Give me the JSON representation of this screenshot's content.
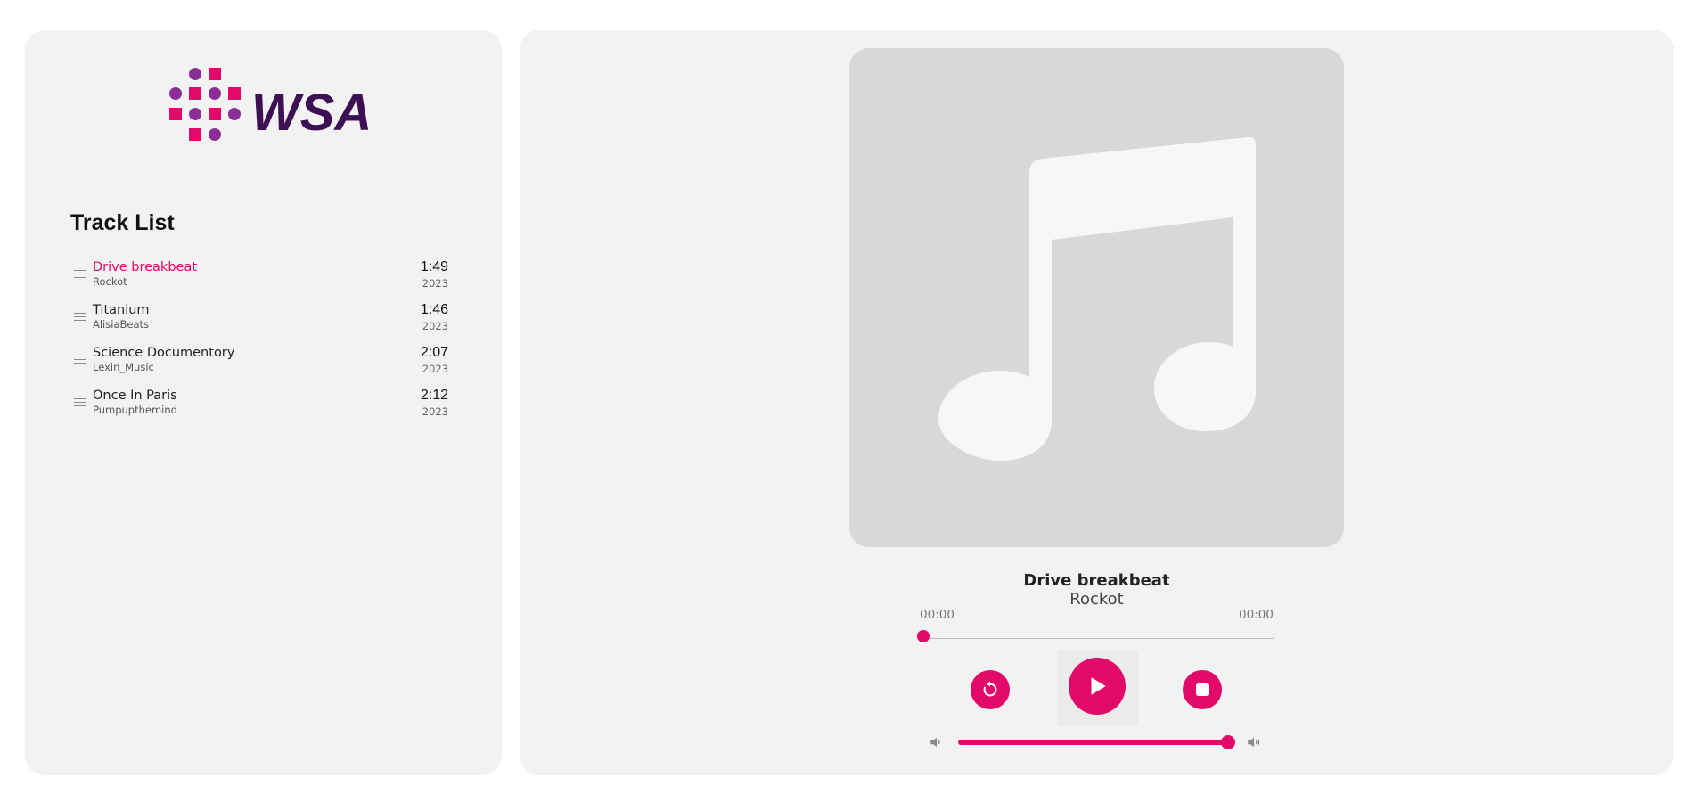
{
  "brand": {
    "name": "WSA",
    "accent": "#e20a68",
    "secondary": "#8b2f97",
    "text_color": "#3c1053"
  },
  "tracklist": {
    "title": "Track List",
    "items": [
      {
        "title": "Drive breakbeat",
        "artist": "Rockot",
        "duration": "1:49",
        "year": "2023",
        "active": true
      },
      {
        "title": "Titanium",
        "artist": "AlisiaBeats",
        "duration": "1:46",
        "year": "2023",
        "active": false
      },
      {
        "title": "Science Documentory",
        "artist": "Lexin_Music",
        "duration": "2:07",
        "year": "2023",
        "active": false
      },
      {
        "title": "Once In Paris",
        "artist": "Pumpupthemind",
        "duration": "2:12",
        "year": "2023",
        "active": false
      }
    ]
  },
  "player": {
    "artwork_icon": "music-note-icon",
    "now_playing": {
      "title": "Drive breakbeat",
      "artist": "Rockot"
    },
    "time": {
      "current": "00:00",
      "total": "00:00"
    },
    "progress_fraction": 0,
    "volume_fraction": 1,
    "controls": {
      "restart_icon": "restart-icon",
      "play_icon": "play-icon",
      "stop_icon": "stop-icon",
      "volume_low_icon": "volume-low-icon",
      "volume_high_icon": "volume-high-icon"
    }
  }
}
